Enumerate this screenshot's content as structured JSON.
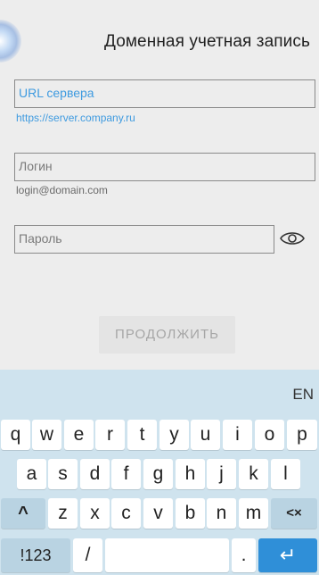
{
  "header": {
    "title": "Доменная учетная запись"
  },
  "form": {
    "url": {
      "placeholder": "URL сервера",
      "hint": "https://server.company.ru"
    },
    "login": {
      "placeholder": "Логин",
      "hint": "login@domain.com"
    },
    "password": {
      "placeholder": "Пароль"
    },
    "continue_label": "ПРОДОЛЖИТЬ"
  },
  "keyboard": {
    "lang": "EN",
    "row1": [
      "q",
      "w",
      "e",
      "r",
      "t",
      "y",
      "u",
      "i",
      "o",
      "p"
    ],
    "row2": [
      "a",
      "s",
      "d",
      "f",
      "g",
      "h",
      "j",
      "k",
      "l"
    ],
    "row3": [
      "z",
      "x",
      "c",
      "v",
      "b",
      "n",
      "m"
    ],
    "shift": "^",
    "backspace": "<×",
    "symbols": "!123",
    "slash": "/",
    "period": ".",
    "enter": "↵"
  }
}
